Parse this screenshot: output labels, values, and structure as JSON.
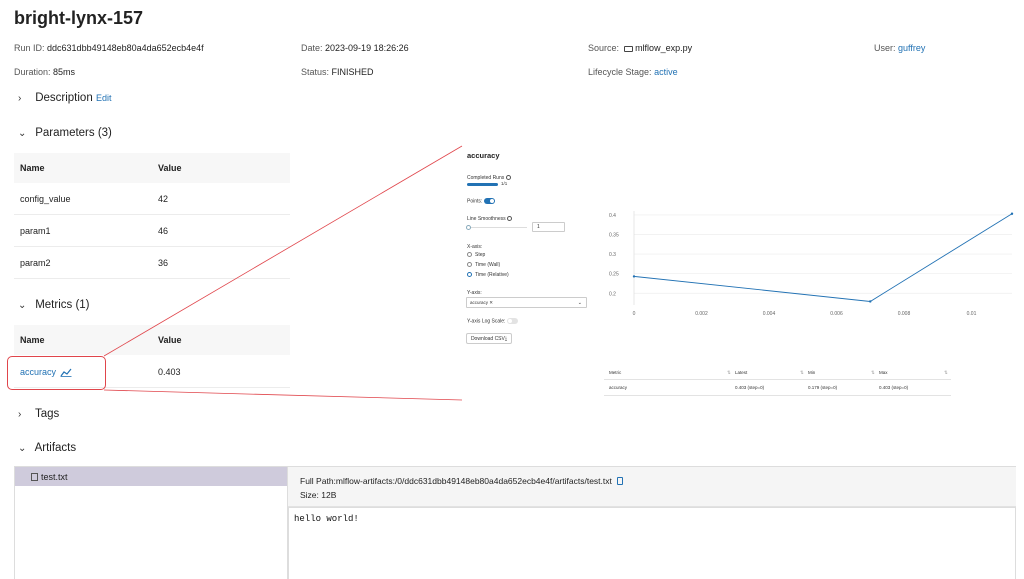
{
  "run": {
    "title": "bright-lynx-157",
    "run_id_label": "Run ID:",
    "run_id": "ddc631dbb49148eb80a4da652ecb4e4f",
    "date_label": "Date:",
    "date": "2023-09-19 18:26:26",
    "source_label": "Source:",
    "source": "mlflow_exp.py",
    "user_label": "User:",
    "user": "guffrey",
    "duration_label": "Duration:",
    "duration": "85ms",
    "status_label": "Status:",
    "status": "FINISHED",
    "lifecycle_label": "Lifecycle Stage:",
    "lifecycle": "active"
  },
  "sections": {
    "description": "Description",
    "edit": "Edit",
    "parameters": "Parameters (3)",
    "metrics": "Metrics (1)",
    "tags": "Tags",
    "artifacts": "Artifacts"
  },
  "parameters": {
    "headers": [
      "Name",
      "Value"
    ],
    "rows": [
      {
        "name": "config_value",
        "value": "42"
      },
      {
        "name": "param1",
        "value": "46"
      },
      {
        "name": "param2",
        "value": "36"
      }
    ]
  },
  "metrics": {
    "headers": [
      "Name",
      "Value"
    ],
    "rows": [
      {
        "name": "accuracy",
        "value": "0.403"
      }
    ]
  },
  "artifacts": {
    "file": "test.txt",
    "full_path_label": "Full Path:",
    "full_path": "mlflow-artifacts:/0/ddc631dbb49148eb80a4da652ecb4e4f/artifacts/test.txt",
    "size_label": "Size:",
    "size": "12B",
    "content": "hello world!"
  },
  "metric_view": {
    "title": "accuracy",
    "completed_runs_label": "Completed Runs",
    "completed_runs": "1/1",
    "points_label": "Points:",
    "points_on": true,
    "smoothness_label": "Line Smoothness",
    "smoothness_value": "1",
    "xaxis_label": "X-axis:",
    "xaxis_options": [
      "Step",
      "Time (Wall)",
      "Time (Relative)"
    ],
    "xaxis_selected": "Time (Relative)",
    "yaxis_label": "Y-axis:",
    "yaxis_value": "accuracy",
    "ylog_label": "Y-axis Log Scale:",
    "ylog_on": false,
    "download_label": "Download CSV",
    "accent": "#2272b4",
    "table_headers": [
      "Metric",
      "Latest",
      "Min",
      "Max"
    ],
    "table_row": [
      "accuracy",
      "0.403 (step=0)",
      "0.179 (step=0)",
      "0.403 (step=0)"
    ]
  },
  "chart_data": {
    "type": "line",
    "x": [
      0,
      0.007,
      0.0112
    ],
    "y": [
      0.243,
      0.179,
      0.403
    ],
    "xticks": [
      "0",
      "0.002",
      "0.004",
      "0.006",
      "0.008",
      "0.01"
    ],
    "xtick_values": [
      0,
      0.002,
      0.004,
      0.006,
      0.008,
      0.01
    ],
    "yticks": [
      "0.2",
      "0.25",
      "0.3",
      "0.35",
      "0.4"
    ],
    "ytick_values": [
      0.2,
      0.25,
      0.3,
      0.35,
      0.4
    ],
    "xlim": [
      0,
      0.0112
    ],
    "ylim": [
      0.17,
      0.41
    ],
    "grid": true,
    "color": "#2272b4"
  }
}
